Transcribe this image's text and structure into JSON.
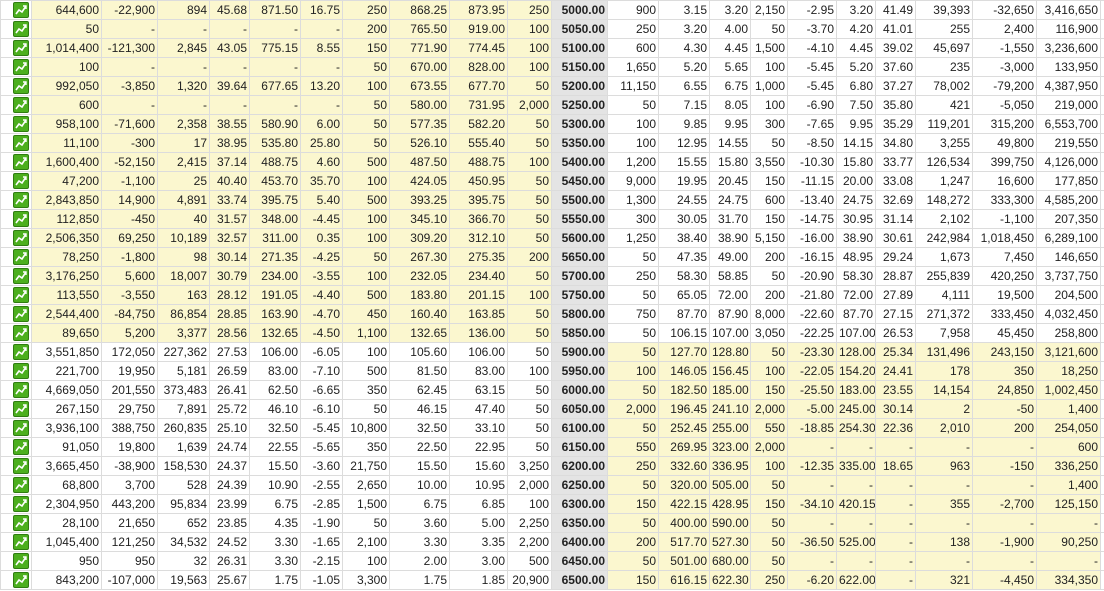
{
  "chart_icon": "trend-chart-icon",
  "highlight_color": "#fbf7cf",
  "strike_bg": "#e4e4e4",
  "rows": [
    {
      "itm_call": true,
      "itm_put": false,
      "cells": [
        "644,600",
        "-22,900",
        "894",
        "45.68",
        "871.50",
        "16.75",
        "250",
        "868.25",
        "873.95",
        "250",
        "5000.00",
        "900",
        "3.15",
        "3.20",
        "2,150",
        "-2.95",
        "3.20",
        "41.49",
        "39,393",
        "-32,650",
        "3,416,650"
      ]
    },
    {
      "itm_call": true,
      "itm_put": false,
      "cells": [
        "50",
        "-",
        "-",
        "-",
        "-",
        "-",
        "200",
        "765.50",
        "919.00",
        "100",
        "5050.00",
        "250",
        "3.20",
        "4.00",
        "50",
        "-3.70",
        "4.20",
        "41.01",
        "255",
        "2,400",
        "116,900"
      ]
    },
    {
      "itm_call": true,
      "itm_put": false,
      "cells": [
        "1,014,400",
        "-121,300",
        "2,845",
        "43.05",
        "775.15",
        "8.55",
        "150",
        "771.90",
        "774.45",
        "100",
        "5100.00",
        "600",
        "4.30",
        "4.45",
        "1,500",
        "-4.10",
        "4.45",
        "39.02",
        "45,697",
        "-1,550",
        "3,236,600"
      ]
    },
    {
      "itm_call": true,
      "itm_put": false,
      "cells": [
        "100",
        "-",
        "-",
        "-",
        "-",
        "-",
        "50",
        "670.00",
        "828.00",
        "100",
        "5150.00",
        "1,650",
        "5.20",
        "5.65",
        "100",
        "-5.45",
        "5.20",
        "37.60",
        "235",
        "-3,000",
        "133,950"
      ]
    },
    {
      "itm_call": true,
      "itm_put": false,
      "cells": [
        "992,050",
        "-3,850",
        "1,320",
        "39.64",
        "677.65",
        "13.20",
        "100",
        "673.55",
        "677.70",
        "50",
        "5200.00",
        "11,150",
        "6.55",
        "6.75",
        "1,000",
        "-5.45",
        "6.80",
        "37.27",
        "78,002",
        "-79,200",
        "4,387,950"
      ]
    },
    {
      "itm_call": true,
      "itm_put": false,
      "cells": [
        "600",
        "-",
        "-",
        "-",
        "-",
        "-",
        "50",
        "580.00",
        "731.95",
        "2,000",
        "5250.00",
        "50",
        "7.15",
        "8.05",
        "100",
        "-6.90",
        "7.50",
        "35.80",
        "421",
        "-5,050",
        "219,000"
      ]
    },
    {
      "itm_call": true,
      "itm_put": false,
      "cells": [
        "958,100",
        "-71,600",
        "2,358",
        "38.55",
        "580.90",
        "6.00",
        "50",
        "577.35",
        "582.20",
        "50",
        "5300.00",
        "100",
        "9.85",
        "9.95",
        "300",
        "-7.65",
        "9.95",
        "35.29",
        "119,201",
        "315,200",
        "6,553,700"
      ]
    },
    {
      "itm_call": true,
      "itm_put": false,
      "cells": [
        "11,100",
        "-300",
        "17",
        "38.95",
        "535.80",
        "25.80",
        "50",
        "526.10",
        "555.40",
        "50",
        "5350.00",
        "100",
        "12.95",
        "14.55",
        "50",
        "-8.50",
        "14.15",
        "34.80",
        "3,255",
        "49,800",
        "219,550"
      ]
    },
    {
      "itm_call": true,
      "itm_put": false,
      "cells": [
        "1,600,400",
        "-52,150",
        "2,415",
        "37.14",
        "488.75",
        "4.60",
        "500",
        "487.50",
        "488.75",
        "100",
        "5400.00",
        "1,200",
        "15.55",
        "15.80",
        "3,550",
        "-10.30",
        "15.80",
        "33.77",
        "126,534",
        "399,750",
        "4,126,000"
      ]
    },
    {
      "itm_call": true,
      "itm_put": false,
      "cells": [
        "47,200",
        "-1,100",
        "25",
        "40.40",
        "453.70",
        "35.70",
        "100",
        "424.05",
        "450.95",
        "50",
        "5450.00",
        "9,000",
        "19.95",
        "20.45",
        "150",
        "-11.15",
        "20.00",
        "33.08",
        "1,247",
        "16,600",
        "177,850"
      ]
    },
    {
      "itm_call": true,
      "itm_put": false,
      "cells": [
        "2,843,850",
        "14,900",
        "4,891",
        "33.74",
        "395.75",
        "5.40",
        "500",
        "393.25",
        "395.75",
        "50",
        "5500.00",
        "1,300",
        "24.55",
        "24.75",
        "600",
        "-13.40",
        "24.75",
        "32.69",
        "148,272",
        "333,300",
        "4,585,200"
      ]
    },
    {
      "itm_call": true,
      "itm_put": false,
      "cells": [
        "112,850",
        "-450",
        "40",
        "31.57",
        "348.00",
        "-4.45",
        "100",
        "345.10",
        "366.70",
        "50",
        "5550.00",
        "300",
        "30.05",
        "31.70",
        "150",
        "-14.75",
        "30.95",
        "31.14",
        "2,102",
        "-1,100",
        "207,350"
      ]
    },
    {
      "itm_call": true,
      "itm_put": false,
      "cells": [
        "2,506,350",
        "69,250",
        "10,189",
        "32.57",
        "311.00",
        "0.35",
        "100",
        "309.20",
        "312.10",
        "50",
        "5600.00",
        "1,250",
        "38.40",
        "38.90",
        "5,150",
        "-16.00",
        "38.90",
        "30.61",
        "242,984",
        "1,018,450",
        "6,289,100"
      ]
    },
    {
      "itm_call": true,
      "itm_put": false,
      "cells": [
        "78,250",
        "-1,800",
        "98",
        "30.14",
        "271.35",
        "-4.25",
        "50",
        "267.30",
        "275.35",
        "200",
        "5650.00",
        "50",
        "47.35",
        "49.00",
        "200",
        "-16.15",
        "48.95",
        "29.24",
        "1,673",
        "7,450",
        "146,650"
      ]
    },
    {
      "itm_call": true,
      "itm_put": false,
      "cells": [
        "3,176,250",
        "5,600",
        "18,007",
        "30.79",
        "234.00",
        "-3.55",
        "100",
        "232.05",
        "234.40",
        "50",
        "5700.00",
        "250",
        "58.30",
        "58.85",
        "50",
        "-20.90",
        "58.30",
        "28.87",
        "255,839",
        "420,250",
        "3,737,750"
      ]
    },
    {
      "itm_call": true,
      "itm_put": false,
      "cells": [
        "113,550",
        "-3,550",
        "163",
        "28.12",
        "191.05",
        "-4.40",
        "500",
        "183.80",
        "201.15",
        "100",
        "5750.00",
        "50",
        "65.05",
        "72.00",
        "200",
        "-21.80",
        "72.00",
        "27.89",
        "4,111",
        "19,500",
        "204,500"
      ]
    },
    {
      "itm_call": true,
      "itm_put": false,
      "cells": [
        "2,544,400",
        "-84,750",
        "86,854",
        "28.85",
        "163.90",
        "-4.70",
        "450",
        "160.40",
        "163.85",
        "50",
        "5800.00",
        "750",
        "87.70",
        "87.90",
        "8,000",
        "-22.60",
        "87.70",
        "27.15",
        "271,372",
        "333,450",
        "4,032,450"
      ]
    },
    {
      "itm_call": true,
      "itm_put": false,
      "cells": [
        "89,650",
        "5,200",
        "3,377",
        "28.56",
        "132.65",
        "-4.50",
        "1,100",
        "132.65",
        "136.00",
        "50",
        "5850.00",
        "50",
        "106.15",
        "107.00",
        "3,050",
        "-22.25",
        "107.00",
        "26.53",
        "7,958",
        "45,450",
        "258,800"
      ]
    },
    {
      "itm_call": false,
      "itm_put": true,
      "cells": [
        "3,551,850",
        "172,050",
        "227,362",
        "27.53",
        "106.00",
        "-6.05",
        "100",
        "105.60",
        "106.00",
        "50",
        "5900.00",
        "50",
        "127.70",
        "128.80",
        "50",
        "-23.30",
        "128.00",
        "25.34",
        "131,496",
        "243,150",
        "3,121,600"
      ]
    },
    {
      "itm_call": false,
      "itm_put": true,
      "cells": [
        "221,700",
        "19,950",
        "5,181",
        "26.59",
        "83.00",
        "-7.10",
        "500",
        "81.50",
        "83.00",
        "100",
        "5950.00",
        "100",
        "146.05",
        "156.45",
        "100",
        "-22.05",
        "154.20",
        "24.41",
        "178",
        "350",
        "18,250"
      ]
    },
    {
      "itm_call": false,
      "itm_put": true,
      "cells": [
        "4,669,050",
        "201,550",
        "373,483",
        "26.41",
        "62.50",
        "-6.65",
        "350",
        "62.45",
        "63.15",
        "50",
        "6000.00",
        "50",
        "182.50",
        "185.00",
        "150",
        "-25.50",
        "183.00",
        "23.55",
        "14,154",
        "24,850",
        "1,002,450"
      ]
    },
    {
      "itm_call": false,
      "itm_put": true,
      "cells": [
        "267,150",
        "29,750",
        "7,891",
        "25.72",
        "46.10",
        "-6.10",
        "50",
        "46.15",
        "47.40",
        "50",
        "6050.00",
        "2,000",
        "196.45",
        "241.10",
        "2,000",
        "-5.00",
        "245.00",
        "30.14",
        "2",
        "-50",
        "1,400"
      ]
    },
    {
      "itm_call": false,
      "itm_put": true,
      "cells": [
        "3,936,100",
        "388,750",
        "260,835",
        "25.10",
        "32.50",
        "-5.45",
        "10,800",
        "32.50",
        "33.10",
        "50",
        "6100.00",
        "50",
        "252.45",
        "255.00",
        "550",
        "-18.85",
        "254.30",
        "22.36",
        "2,010",
        "200",
        "254,050"
      ]
    },
    {
      "itm_call": false,
      "itm_put": true,
      "cells": [
        "91,050",
        "19,800",
        "1,639",
        "24.74",
        "22.55",
        "-5.65",
        "350",
        "22.50",
        "22.95",
        "50",
        "6150.00",
        "550",
        "269.95",
        "323.00",
        "2,000",
        "-",
        "-",
        "-",
        "-",
        "-",
        "600"
      ]
    },
    {
      "itm_call": false,
      "itm_put": true,
      "cells": [
        "3,665,450",
        "-38,900",
        "158,530",
        "24.37",
        "15.50",
        "-3.60",
        "21,750",
        "15.50",
        "15.60",
        "3,250",
        "6200.00",
        "250",
        "332.60",
        "336.95",
        "100",
        "-12.35",
        "335.00",
        "18.65",
        "963",
        "-150",
        "336,250"
      ]
    },
    {
      "itm_call": false,
      "itm_put": true,
      "cells": [
        "68,800",
        "3,700",
        "528",
        "24.39",
        "10.90",
        "-2.55",
        "2,650",
        "10.00",
        "10.95",
        "2,000",
        "6250.00",
        "50",
        "320.00",
        "505.00",
        "50",
        "-",
        "-",
        "-",
        "-",
        "-",
        "1,400"
      ]
    },
    {
      "itm_call": false,
      "itm_put": true,
      "cells": [
        "2,304,950",
        "443,200",
        "95,834",
        "23.99",
        "6.75",
        "-2.85",
        "1,500",
        "6.75",
        "6.85",
        "100",
        "6300.00",
        "150",
        "422.15",
        "428.95",
        "150",
        "-34.10",
        "420.15",
        "-",
        "355",
        "-2,700",
        "125,150"
      ]
    },
    {
      "itm_call": false,
      "itm_put": true,
      "cells": [
        "28,100",
        "21,650",
        "652",
        "23.85",
        "4.35",
        "-1.90",
        "50",
        "3.60",
        "5.00",
        "2,250",
        "6350.00",
        "50",
        "400.00",
        "590.00",
        "50",
        "-",
        "-",
        "-",
        "-",
        "-",
        "-"
      ]
    },
    {
      "itm_call": false,
      "itm_put": true,
      "cells": [
        "1,045,400",
        "121,250",
        "34,532",
        "24.52",
        "3.30",
        "-1.65",
        "2,100",
        "3.30",
        "3.35",
        "2,200",
        "6400.00",
        "200",
        "517.70",
        "527.30",
        "50",
        "-36.50",
        "525.00",
        "-",
        "138",
        "-1,900",
        "90,250"
      ]
    },
    {
      "itm_call": false,
      "itm_put": true,
      "cells": [
        "950",
        "950",
        "32",
        "26.31",
        "3.30",
        "-2.15",
        "100",
        "2.00",
        "3.00",
        "500",
        "6450.00",
        "50",
        "501.00",
        "680.00",
        "50",
        "-",
        "-",
        "-",
        "-",
        "-",
        "-"
      ]
    },
    {
      "itm_call": false,
      "itm_put": true,
      "cells": [
        "843,200",
        "-107,000",
        "19,563",
        "25.67",
        "1.75",
        "-1.05",
        "3,300",
        "1.75",
        "1.85",
        "20,900",
        "6500.00",
        "150",
        "616.15",
        "622.30",
        "250",
        "-6.20",
        "622.00",
        "-",
        "321",
        "-4,450",
        "334,350"
      ]
    }
  ]
}
